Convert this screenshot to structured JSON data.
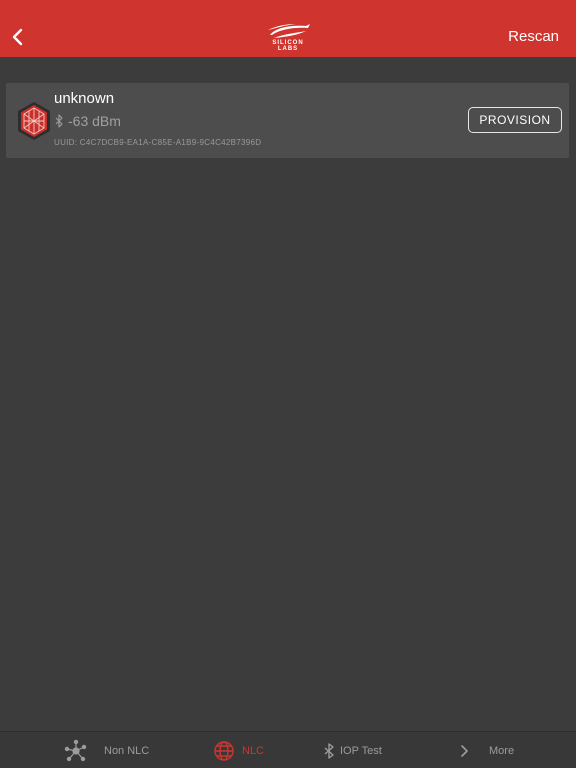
{
  "header": {
    "back_icon": "chevron-left-icon",
    "logo_text": "SILICON LABS",
    "rescan_label": "Rescan"
  },
  "device": {
    "name": "unknown",
    "rssi": "-63 dBm",
    "uuid": "UUID: C4C7DCB9-EA1A-C85E-A1B9-9C4C42B7396D",
    "action_label": "PROVISION",
    "icon": "mesh-node-icon"
  },
  "tabs": [
    {
      "label": "Non NLC",
      "icon": "network-nodes-icon",
      "active": false
    },
    {
      "label": "NLC",
      "icon": "globe-icon",
      "active": true
    },
    {
      "label": "IOP Test",
      "icon": "bluetooth-icon",
      "active": false
    },
    {
      "label": "More",
      "icon": "chevron-right-icon",
      "active": false
    }
  ],
  "colors": {
    "accent": "#d0342f",
    "background": "#3c3c3c",
    "card": "#4d4d4d"
  }
}
